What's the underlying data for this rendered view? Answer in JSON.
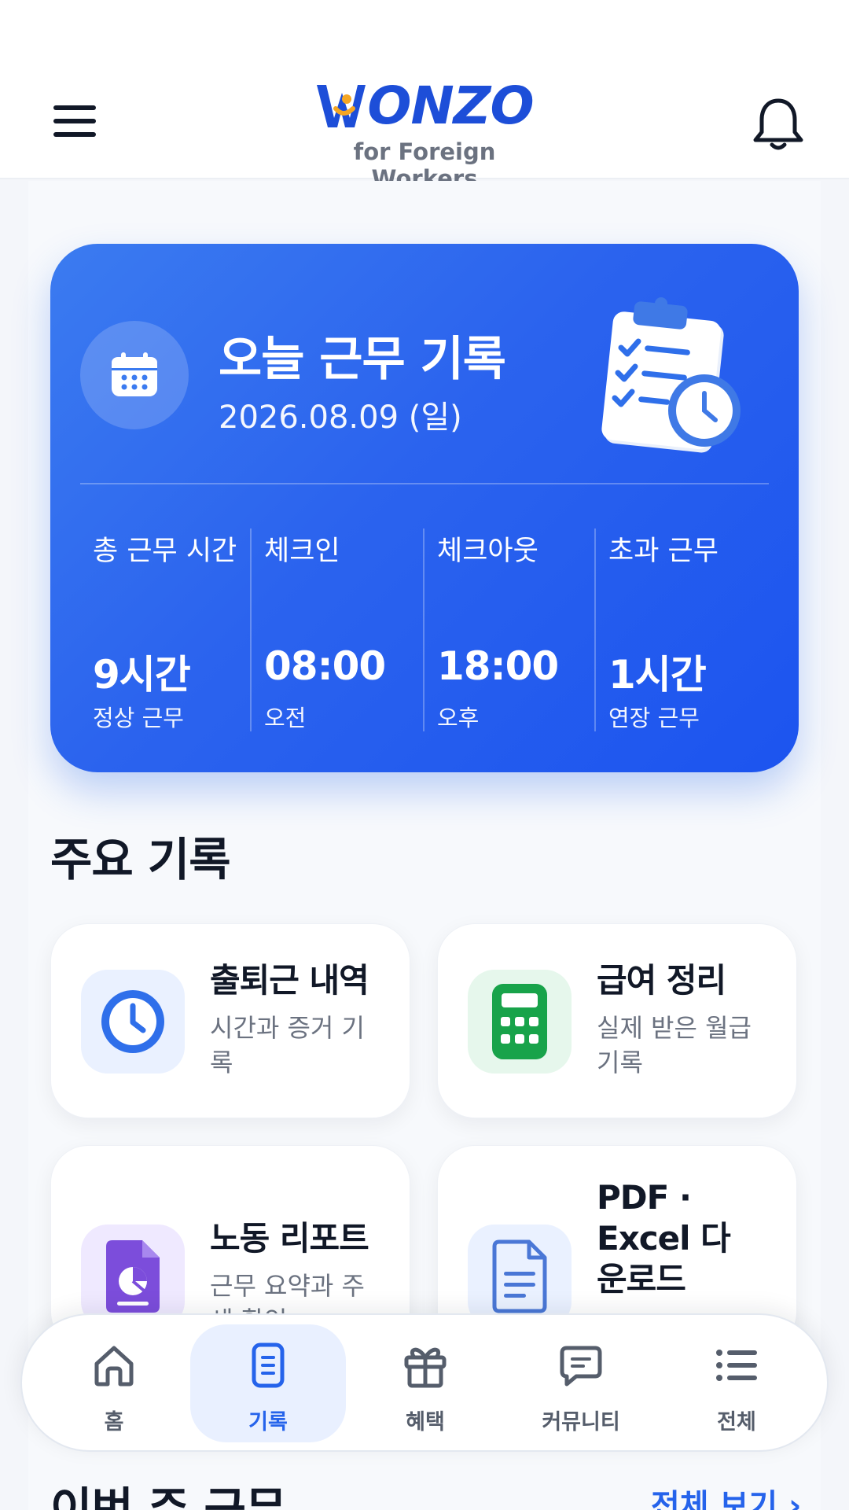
{
  "header": {
    "logo_text_rest": "ONZO",
    "logo_subtitle": "for Foreign Workers",
    "menu_icon": "hamburger-menu-icon",
    "notification_icon": "bell-icon"
  },
  "today_card": {
    "title": "오늘 근무 기록",
    "date": "2026.08.09 (일)",
    "icon": "calendar-icon",
    "illustration": "clipboard-clock-icon",
    "stats": [
      {
        "label": "총 근무 시간",
        "value": "9시간",
        "sub": "정상 근무"
      },
      {
        "label": "체크인",
        "value": "08:00",
        "sub": "오전"
      },
      {
        "label": "체크아웃",
        "value": "18:00",
        "sub": "오후"
      },
      {
        "label": "초과 근무",
        "value": "1시간",
        "sub": "연장 근무"
      }
    ]
  },
  "main_records": {
    "title": "주요 기록",
    "tiles": [
      {
        "title": "출퇴근 내역",
        "desc": "시간과 증거 기록",
        "icon": "clock-icon",
        "icon_color": "#2f6fea",
        "icon_bg": "#eaf1ff"
      },
      {
        "title": "급여 정리",
        "desc": "실제 받은 월급 기록",
        "icon": "calculator-icon",
        "icon_color": "#18a34a",
        "icon_bg": "#e6f7ec"
      },
      {
        "title": "노동 리포트",
        "desc": "근무 요약과 주세 확인",
        "icon": "report-icon",
        "icon_color": "#7c4ddb",
        "icon_bg": "#efe9ff"
      },
      {
        "title": "PDF · Excel 다운로드",
        "desc": "",
        "icon": "document-icon",
        "icon_color": "#4a77d6",
        "icon_bg": "#eaf1ff"
      }
    ]
  },
  "week_section": {
    "title": "이번 주 근무",
    "see_all": "전체 보기 ›"
  },
  "bottom_nav": {
    "items": [
      {
        "label": "홈",
        "icon": "home-icon",
        "active": false
      },
      {
        "label": "기록",
        "icon": "record-icon",
        "active": true
      },
      {
        "label": "혜택",
        "icon": "gift-icon",
        "active": false
      },
      {
        "label": "커뮤니티",
        "icon": "chat-icon",
        "active": false
      },
      {
        "label": "전체",
        "icon": "list-icon",
        "active": false
      }
    ]
  },
  "colors": {
    "brand_blue": "#1d4ed8",
    "accent_orange": "#f5a623",
    "active_nav": "#2563eb"
  }
}
